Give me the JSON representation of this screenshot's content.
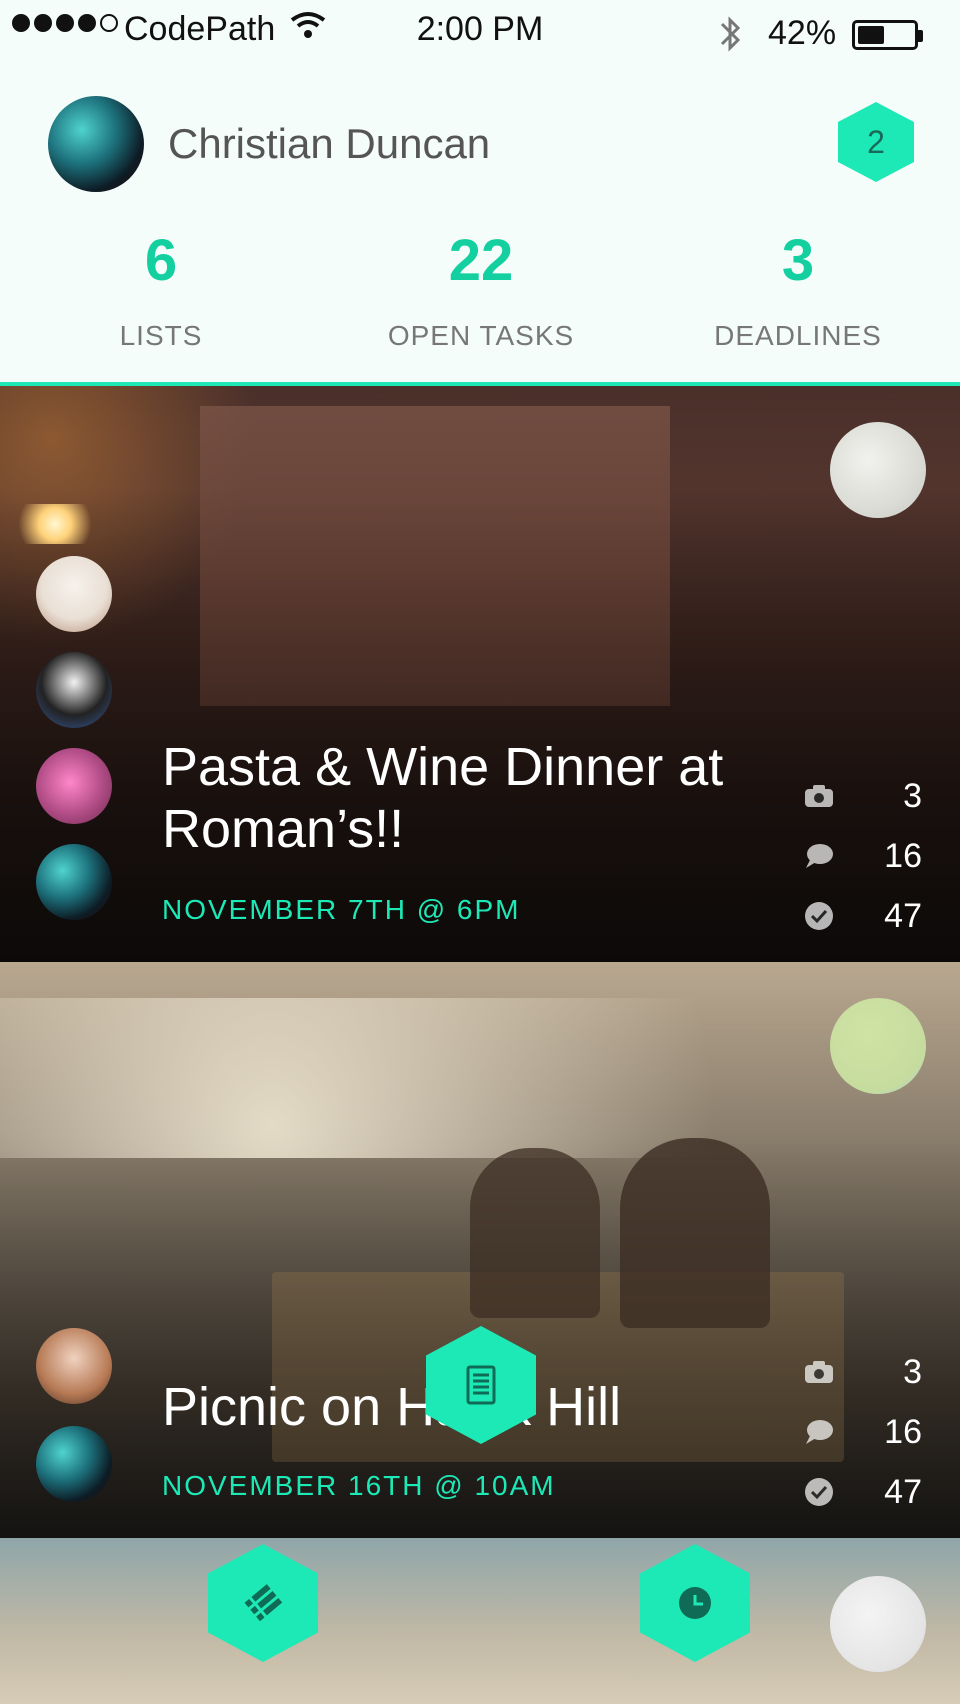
{
  "status_bar": {
    "carrier": "CodePath",
    "time": "2:00 PM",
    "battery_percent": "42%",
    "battery_level": 0.42,
    "signal_bars": 4,
    "signal_total": 5,
    "icons": [
      "wifi-icon",
      "bluetooth-icon",
      "battery-icon"
    ]
  },
  "profile": {
    "name": "Christian Duncan",
    "notification_count": "2"
  },
  "stats": [
    {
      "value": "6",
      "label": "LISTS"
    },
    {
      "value": "22",
      "label": "OPEN TASKS"
    },
    {
      "value": "3",
      "label": "DEADLINES"
    }
  ],
  "cards": [
    {
      "title": "Pasta & Wine Dinner at Roman’s!!",
      "date": "NOVEMBER 7TH @ 6PM",
      "photos": "3",
      "comments": "16",
      "completed": "47",
      "members": [
        "sheep-avatar",
        "panda-avatar",
        "pink-sunglasses-avatar",
        "teal-avatar"
      ]
    },
    {
      "title": "Picnic on Hawk Hill",
      "date": "NOVEMBER 16TH @ 10AM",
      "photos": "3",
      "comments": "16",
      "completed": "47",
      "members": [
        "woman-avatar",
        "teal-avatar"
      ]
    }
  ],
  "fabs": [
    "document-icon",
    "list-icon",
    "clock-icon"
  ],
  "colors": {
    "accent": "#1de9b6",
    "stat_number": "#14d0a0",
    "header_bg": "#f4fdfa"
  }
}
